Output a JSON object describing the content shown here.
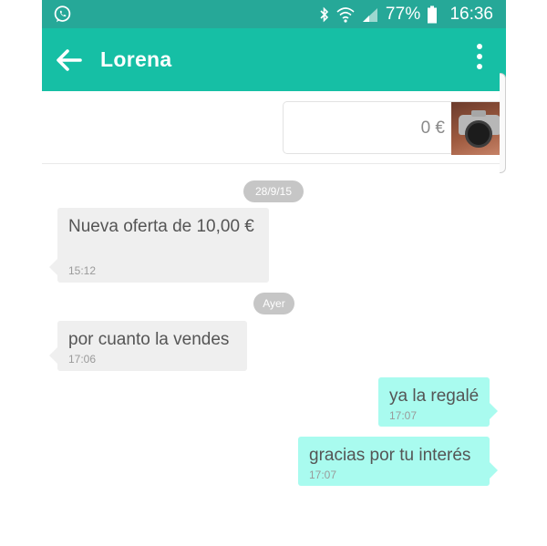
{
  "status_bar": {
    "battery_percent": "77%",
    "time": "16:36",
    "icons": [
      "whatsapp-icon",
      "bluetooth-icon",
      "wifi-icon",
      "signal-icon",
      "battery-icon"
    ]
  },
  "app_bar": {
    "title": "Lorena",
    "colors": {
      "status_bar": "#26a898",
      "app_bar": "#16bfa5"
    }
  },
  "product": {
    "price": "0 €"
  },
  "chat": {
    "date_separators": [
      "28/9/15",
      "Ayer"
    ],
    "messages": [
      {
        "direction": "in",
        "text": "Nueva oferta de 10,00 €",
        "time": "15:12"
      },
      {
        "direction": "in",
        "text": "por cuanto la vendes",
        "time": "17:06"
      },
      {
        "direction": "out",
        "text": "ya la regalé",
        "time": "17:07"
      },
      {
        "direction": "out",
        "text": "gracias por tu interés",
        "time": "17:07"
      }
    ],
    "colors": {
      "incoming_bubble": "#efefef",
      "outgoing_bubble": "#a9fbef",
      "date_pill": "#c6c6c6"
    }
  }
}
